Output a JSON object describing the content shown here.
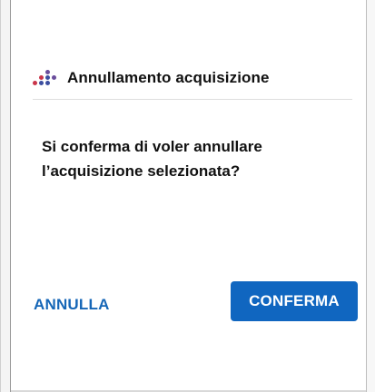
{
  "dialog": {
    "title": "Annullamento acquisizione",
    "logo_icon": "dots-logo-icon",
    "logo_colors": {
      "red": "#c9354a",
      "blue": "#3c4ea0",
      "purple": "#6a4d9c"
    },
    "message": "Si conferma di voler annullare l’acquisizione selezionata?",
    "cancel_label": "ANNULLA",
    "confirm_label": "CONFERMA"
  },
  "colors": {
    "accent": "#1066c0",
    "link": "#1566b7",
    "text": "#111111",
    "divider": "#dedede"
  }
}
